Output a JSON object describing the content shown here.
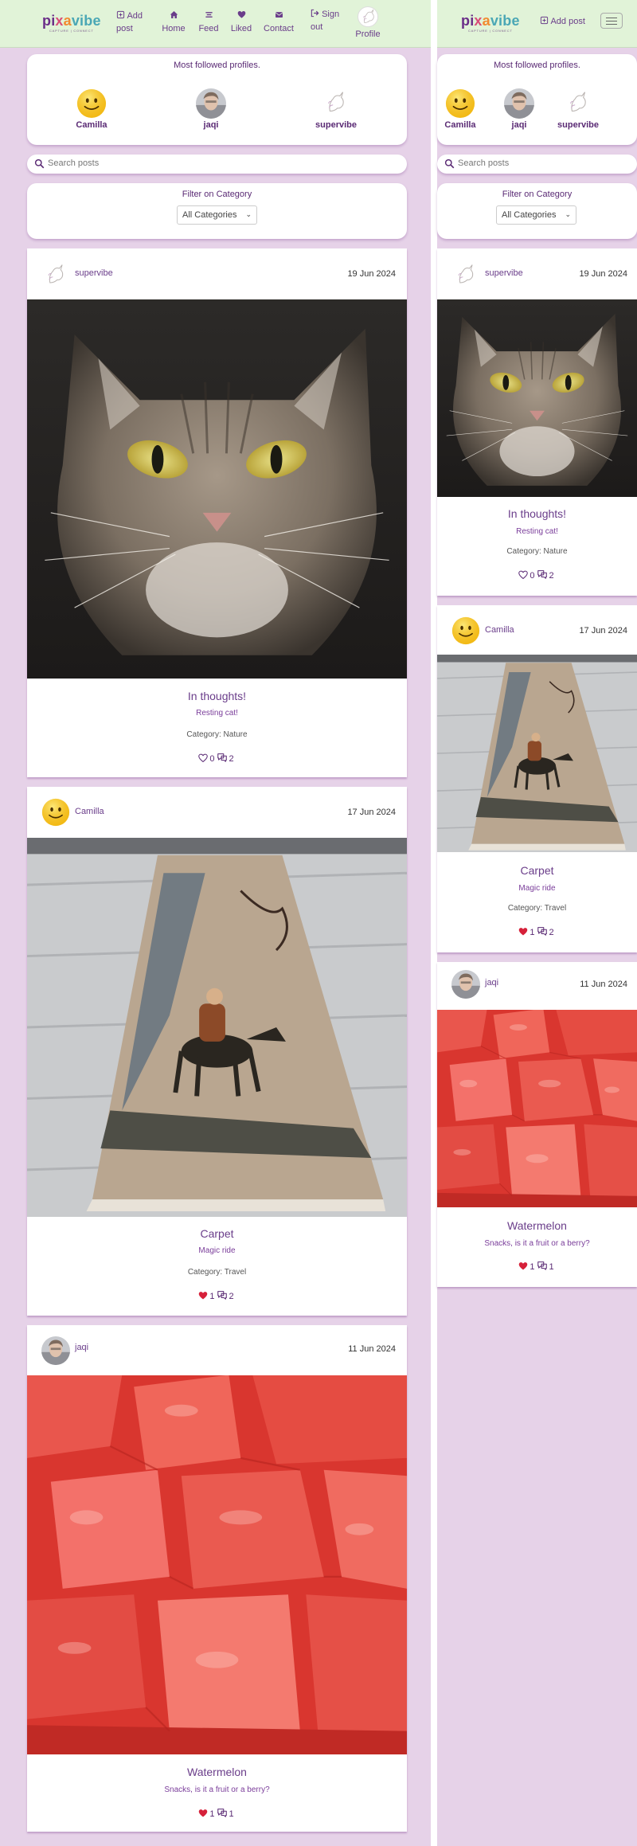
{
  "brand": {
    "name_parts": [
      "pi",
      "x",
      "a",
      "vibe"
    ],
    "tagline": "CAPTURE | CONNECT"
  },
  "nav": {
    "add_post": "Add post",
    "home": "Home",
    "feed": "Feed",
    "liked": "Liked",
    "contact": "Contact",
    "sign_out": "Sign out",
    "profile": "Profile"
  },
  "followed": {
    "title": "Most followed profiles.",
    "profiles": [
      {
        "name": "Camilla"
      },
      {
        "name": "jaqi"
      },
      {
        "name": "supervibe"
      }
    ]
  },
  "search": {
    "placeholder": "Search posts"
  },
  "filter": {
    "title": "Filter on Category",
    "selected": "All Categories"
  },
  "posts": [
    {
      "user": "supervibe",
      "date": "19 Jun 2024",
      "title": "In thoughts!",
      "description": "Resting cat!",
      "category": "Category: Nature",
      "likes": "0",
      "comments": "2",
      "liked": false
    },
    {
      "user": "Camilla",
      "date": "17 Jun 2024",
      "title": "Carpet",
      "description": "Magic ride",
      "category": "Category: Travel",
      "likes": "1",
      "comments": "2",
      "liked": true
    },
    {
      "user": "jaqi",
      "date": "11 Jun 2024",
      "title": "Watermelon",
      "description": "Snacks, is it a fruit or a berry?",
      "category": "",
      "likes": "1",
      "comments": "1",
      "liked": true
    }
  ],
  "colors": {
    "accent": "#5a2a74",
    "background": "#e6d2e8",
    "navbar": "#e1f3d8",
    "heart": "#d6213a"
  },
  "icons": [
    "plus-square-icon",
    "home-icon",
    "feed-icon",
    "heart-icon",
    "envelope-icon",
    "sign-out-icon",
    "search-icon",
    "comment-icon",
    "hamburger-icon"
  ]
}
